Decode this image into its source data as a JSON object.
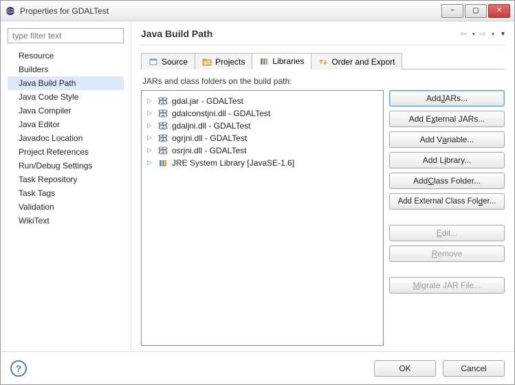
{
  "window": {
    "title": "Properties for GDALTest"
  },
  "sidebar": {
    "filter_placeholder": "type filter text",
    "items": [
      {
        "label": "Resource"
      },
      {
        "label": "Builders"
      },
      {
        "label": "Java Build Path",
        "selected": true
      },
      {
        "label": "Java Code Style"
      },
      {
        "label": "Java Compiler"
      },
      {
        "label": "Java Editor"
      },
      {
        "label": "Javadoc Location"
      },
      {
        "label": "Project References"
      },
      {
        "label": "Run/Debug Settings"
      },
      {
        "label": "Task Repository"
      },
      {
        "label": "Task Tags"
      },
      {
        "label": "Validation"
      },
      {
        "label": "WikiText"
      }
    ]
  },
  "main": {
    "title": "Java Build Path",
    "tabs": [
      {
        "label": "Source"
      },
      {
        "label": "Projects"
      },
      {
        "label": "Libraries",
        "active": true
      },
      {
        "label": "Order and Export"
      }
    ],
    "subtitle": "JARs and class folders on the build path:",
    "entries": [
      {
        "label": "gdal.jar - GDALTest",
        "kind": "jar"
      },
      {
        "label": "gdalconstjni.dll - GDALTest",
        "kind": "jar"
      },
      {
        "label": "gdaljni.dll - GDALTest",
        "kind": "jar"
      },
      {
        "label": "ogrjni.dll - GDALTest",
        "kind": "jar"
      },
      {
        "label": "osrjni.dll - GDALTest",
        "kind": "jar"
      },
      {
        "label": "JRE System Library [JavaSE-1.6]",
        "kind": "lib"
      }
    ],
    "buttons": {
      "add_jars": "Add JARs...",
      "add_ext_jars": "Add External JARs...",
      "add_variable": "Add Variable...",
      "add_library": "Add Library...",
      "add_class_folder": "Add Class Folder...",
      "add_ext_class_folder": "Add External Class Folder...",
      "edit": "Edit...",
      "remove": "Remove",
      "migrate": "Migrate JAR File..."
    }
  },
  "footer": {
    "ok": "OK",
    "cancel": "Cancel"
  }
}
